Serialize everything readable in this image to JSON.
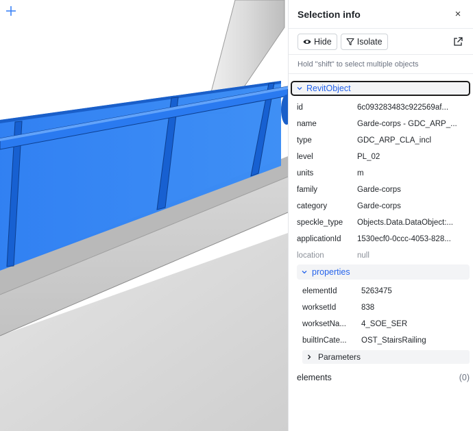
{
  "panel": {
    "title": "Selection info",
    "close_symbol": "×",
    "hide_label": "Hide",
    "isolate_label": "Isolate",
    "hint": "Hold \"shift\" to select multiple objects"
  },
  "object": {
    "name": "RevitObject",
    "fields": [
      {
        "key": "id",
        "value": "6c093283483c922569af..."
      },
      {
        "key": "name",
        "value": "Garde-corps - GDC_ARP_..."
      },
      {
        "key": "type",
        "value": "GDC_ARP_CLA_incl"
      },
      {
        "key": "level",
        "value": "PL_02"
      },
      {
        "key": "units",
        "value": "m"
      },
      {
        "key": "family",
        "value": "Garde-corps"
      },
      {
        "key": "category",
        "value": "Garde-corps"
      },
      {
        "key": "speckle_type",
        "value": "Objects.Data.DataObject:..."
      },
      {
        "key": "applicationId",
        "value": "1530ecf0-0ccc-4053-828..."
      },
      {
        "key": "location",
        "value": "null"
      }
    ]
  },
  "properties": {
    "label": "properties",
    "fields": [
      {
        "key": "elementId",
        "value": "5263475"
      },
      {
        "key": "worksetId",
        "value": "838"
      },
      {
        "key": "worksetNa...",
        "value": "4_SOE_SER"
      },
      {
        "key": "builtInCate...",
        "value": "OST_StairsRailing"
      }
    ],
    "parameters_label": "Parameters"
  },
  "elements": {
    "label": "elements",
    "count": "(0)"
  },
  "colors": {
    "accent": "#2563eb",
    "glass": "#2e7ff0",
    "rail": "#1e6fe0"
  }
}
